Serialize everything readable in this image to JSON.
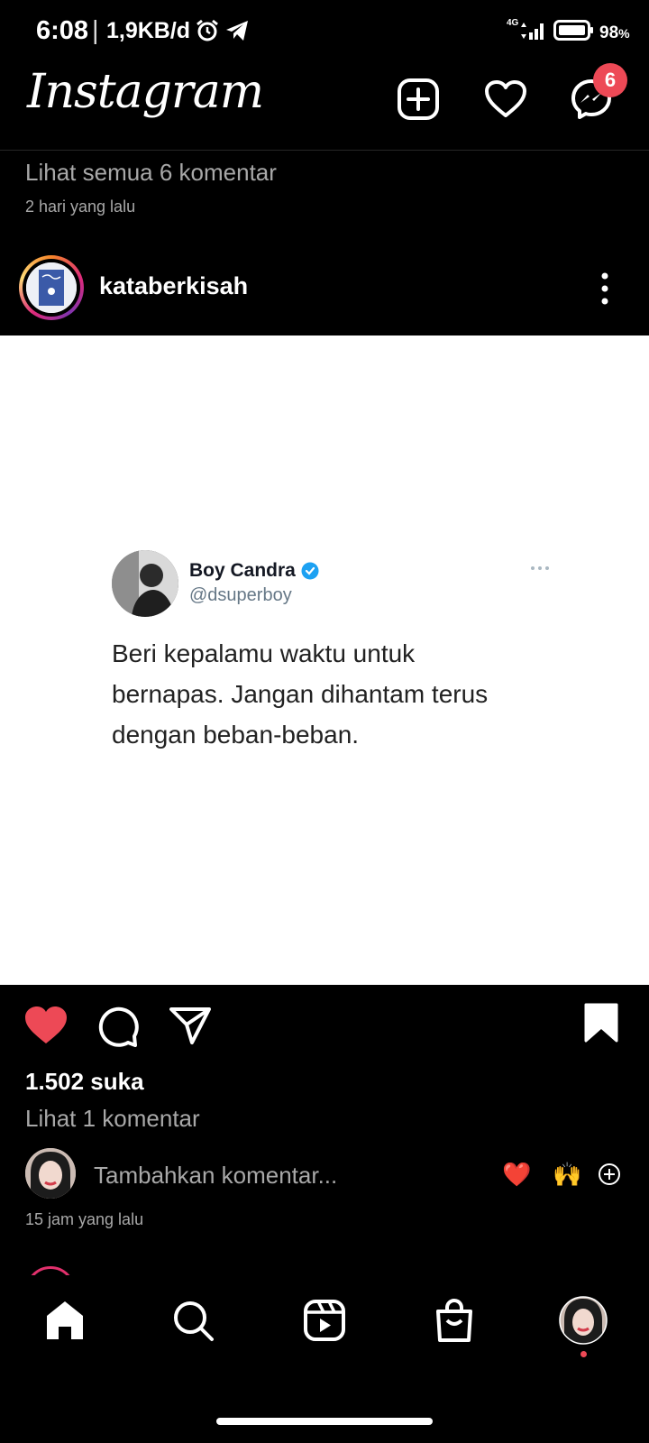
{
  "status_bar": {
    "time": "6:08",
    "separator": "|",
    "net_speed": "1,9KB/d",
    "network_type": "4G",
    "battery_percent": "98",
    "battery_unit": "%"
  },
  "header": {
    "logo": "Instagram",
    "messages_badge": "6"
  },
  "previous_post": {
    "view_all_comments": "Lihat semua 6 komentar",
    "time_ago": "2 hari yang lalu"
  },
  "post": {
    "username": "kataberkisah",
    "tweet": {
      "author_name": "Boy Candra",
      "author_handle": "@dsuperboy",
      "text_lines": [
        "Beri kepalamu waktu untuk",
        "bernapas. Jangan dihantam terus",
        "dengan beban-beban."
      ]
    },
    "liked": true,
    "saved": true,
    "likes": "1.502 suka",
    "view_comments": "Lihat 1 komentar",
    "comment_placeholder": "Tambahkan komentar...",
    "quick_emojis": [
      "❤️",
      "🙌"
    ],
    "time_ago": "15 jam yang lalu"
  },
  "colors": {
    "like_red": "#ed4956",
    "badge_red": "#ed4956",
    "verified_blue": "#1da1f2",
    "secondary_text": "#a8a8a8"
  },
  "bottom_nav": {
    "items": [
      "home-icon",
      "search-icon",
      "reels-icon",
      "shop-icon",
      "profile-avatar"
    ],
    "active": "home-icon"
  }
}
